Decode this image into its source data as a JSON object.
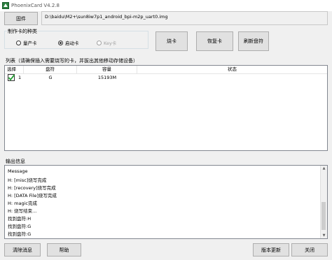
{
  "window": {
    "title": "PhoenixCard V4.2.8"
  },
  "toolbar": {
    "firmware_label": "固件",
    "firmware_path": "D:\\baidu\\M2+\\sun8iw7p1_android_bpi-m2p_uart0.img"
  },
  "card_type": {
    "title": "制作卡的种类",
    "options": [
      {
        "label": "量产卡",
        "selected": false,
        "enabled": true
      },
      {
        "label": "启动卡",
        "selected": true,
        "enabled": true
      },
      {
        "label": "Key卡",
        "selected": false,
        "enabled": false
      }
    ]
  },
  "actions": {
    "burn_label": "烧卡",
    "restore_label": "恢复卡",
    "refresh_label": "刷新盘符"
  },
  "list": {
    "title": "列表（请确保插入需要烧写的卡，并拔出其他移动存储设备）",
    "columns": [
      "选择",
      "盘符",
      "容量",
      "状态"
    ],
    "rows": [
      {
        "checked": true,
        "index": "1",
        "drive": "G",
        "capacity": "15193M",
        "status": ""
      }
    ]
  },
  "output": {
    "title": "输出信息",
    "lines": [
      "Message",
      "H: [misc]烧写完成",
      "H: [recovery]烧写完成",
      "H: [DATA File]烧写完成",
      "H: magic完成",
      "H: 烧写结束...",
      "找到盘符:H",
      "找到盘符:G",
      "找到盘符:G"
    ]
  },
  "bottom": {
    "clear_label": "清除消息",
    "help_label": "帮助",
    "update_label": "版本更新",
    "close_label": "关闭"
  },
  "colors": {
    "check_green": "#1e9e2e",
    "border": "#adadad"
  }
}
